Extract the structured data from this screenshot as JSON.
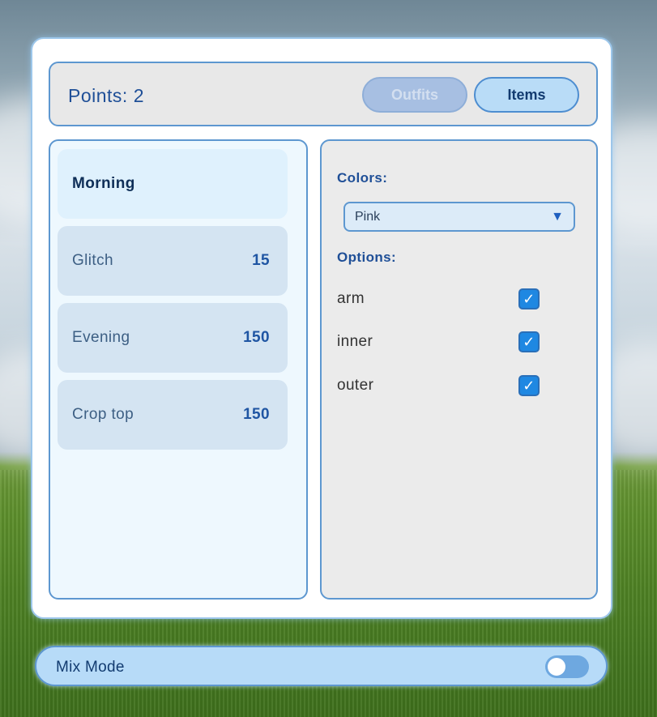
{
  "header": {
    "points_text": "Points: 2",
    "tabs": [
      {
        "label": "Outfits",
        "active": false
      },
      {
        "label": "Items",
        "active": true
      }
    ]
  },
  "list": {
    "items": [
      {
        "name": "Morning",
        "price": "",
        "selected": true
      },
      {
        "name": "Glitch",
        "price": "15",
        "selected": false
      },
      {
        "name": "Evening",
        "price": "150",
        "selected": false
      },
      {
        "name": "Crop top",
        "price": "150",
        "selected": false
      }
    ]
  },
  "options_panel": {
    "colors_label": "Colors:",
    "color_select_value": "Pink",
    "options_label": "Options:",
    "options": [
      {
        "label": "arm",
        "checked": true
      },
      {
        "label": "inner",
        "checked": true
      },
      {
        "label": "outer",
        "checked": true
      }
    ]
  },
  "mix_mode": {
    "label": "Mix Mode",
    "enabled": false
  },
  "colors": {
    "accent": "#1f4f97",
    "border": "#5d97d0",
    "checkbox": "#1f88e2"
  }
}
